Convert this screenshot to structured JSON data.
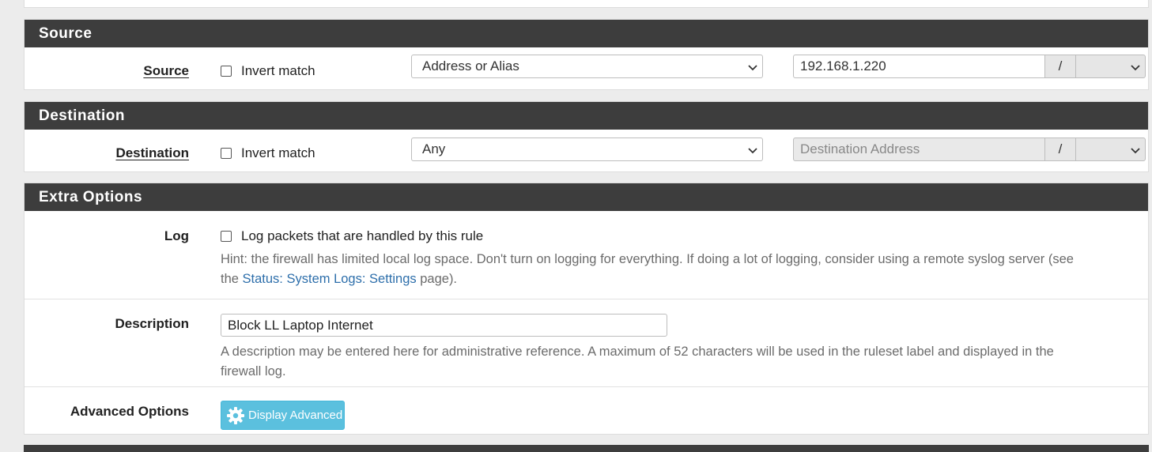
{
  "source": {
    "heading": "Source",
    "label": "Source",
    "invert_label": "Invert match",
    "type_value": "Address or Alias",
    "address_value": "192.168.1.220",
    "slash": "/",
    "mask_value": ""
  },
  "destination": {
    "heading": "Destination",
    "label": "Destination",
    "invert_label": "Invert match",
    "type_value": "Any",
    "address_placeholder": "Destination Address",
    "slash": "/",
    "mask_value": ""
  },
  "extra": {
    "heading": "Extra Options",
    "log_label": "Log",
    "log_check_label": "Log packets that are handled by this rule",
    "log_hint_1": "Hint: the firewall has limited local log space. Don't turn on logging for everything. If doing a lot of logging, consider using a remote syslog server (see",
    "log_hint_the": "the",
    "log_hint_link": "Status: System Logs: Settings",
    "log_hint_end": "page).",
    "description_label": "Description",
    "description_value": "Block LL Laptop Internet",
    "description_hint_1": "A description may be entered here for administrative reference. A maximum of 52 characters will be used in the ruleset label and displayed in the",
    "description_hint_2": "firewall log.",
    "advanced_label": "Advanced Options",
    "advanced_button": "Display Advanced"
  },
  "colors": {
    "heading_bg": "#3d3d3d",
    "button_info": "#5bc0de",
    "link": "#2e6fab"
  },
  "icons": {
    "select_arrow": "chevron-down-icon",
    "advanced": "gear-icon"
  }
}
